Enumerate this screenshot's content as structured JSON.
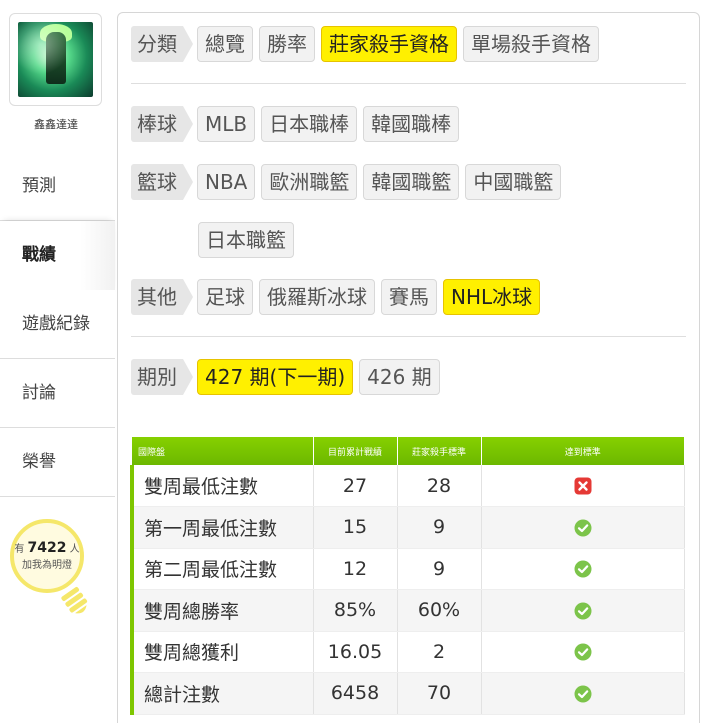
{
  "user": {
    "name": "鑫鑫達達"
  },
  "nav": [
    {
      "label": "預測",
      "active": false
    },
    {
      "label": "戰績",
      "active": true
    },
    {
      "label": "遊戲紀錄",
      "active": false
    },
    {
      "label": "討論",
      "active": false
    },
    {
      "label": "榮譽",
      "active": false
    }
  ],
  "bulb": {
    "prefix": "有",
    "count": "7422",
    "suffix": "人",
    "line2": "加我為明燈"
  },
  "filters": {
    "category": {
      "label": "分類",
      "options": [
        "總覽",
        "勝率",
        "莊家殺手資格",
        "單場殺手資格"
      ],
      "selected": "莊家殺手資格"
    },
    "baseball": {
      "label": "棒球",
      "options": [
        "MLB",
        "日本職棒",
        "韓國職棒"
      ]
    },
    "basketball": {
      "label": "籃球",
      "options": [
        "NBA",
        "歐洲職籃",
        "韓國職籃",
        "中國職籃",
        "日本職籃"
      ]
    },
    "other": {
      "label": "其他",
      "options": [
        "足球",
        "俄羅斯冰球",
        "賽馬",
        "NHL冰球"
      ],
      "selected": "NHL冰球"
    },
    "period": {
      "label": "期別",
      "options": [
        "427 期(下一期)",
        "426 期"
      ],
      "selected": "427 期(下一期)"
    }
  },
  "table": {
    "headers": [
      "國際盤",
      "目前累計戰績",
      "莊家殺手標準",
      "達到標準"
    ],
    "rows": [
      {
        "name": "雙周最低注數",
        "current": "27",
        "standard": "28",
        "met": false
      },
      {
        "name": "第一周最低注數",
        "current": "15",
        "standard": "9",
        "met": true
      },
      {
        "name": "第二周最低注數",
        "current": "12",
        "standard": "9",
        "met": true
      },
      {
        "name": "雙周總勝率",
        "current": "85%",
        "standard": "60%",
        "met": true
      },
      {
        "name": "雙周總獲利",
        "current": "16.05",
        "standard": "2",
        "met": true
      },
      {
        "name": "總計注數",
        "current": "6458",
        "standard": "70",
        "met": true
      }
    ]
  },
  "colors": {
    "accent_green": "#7ec600",
    "highlight_yellow": "#fff000",
    "fail_red": "#e53935",
    "pass_green": "#7cc44a"
  }
}
